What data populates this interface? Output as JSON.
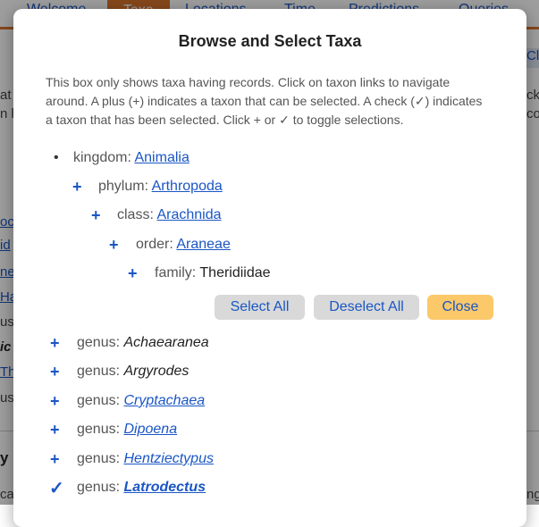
{
  "background": {
    "tabs": [
      {
        "label": "Welcome",
        "active": false
      },
      {
        "label": "Taxa",
        "active": true
      },
      {
        "label": "Locations",
        "active": false
      },
      {
        "label": "Time",
        "active": false
      },
      {
        "label": "Predictions",
        "active": false
      },
      {
        "label": "Queries",
        "active": false
      }
    ],
    "right_button_fragment": "Cle",
    "left_fragments": [
      "at",
      "n l",
      "oc",
      "id",
      "ne",
      "Ha",
      "us:",
      "ic",
      "Th",
      "us:",
      "y",
      "ca"
    ],
    "right_fragments": [
      "ck",
      "co",
      "ng"
    ]
  },
  "modal": {
    "title": "Browse and Select Taxa",
    "description": "This box only shows taxa having records. Click on taxon links to navigate around. A plus (+) indicates a taxon that can be selected. A check (✓) indicates a taxon that has been selected. Click + or ✓ to toggle selections.",
    "hierarchy": [
      {
        "rank": "kingdom:",
        "name": "Animalia",
        "link": true,
        "marker": "bullet"
      },
      {
        "rank": "phylum:",
        "name": "Arthropoda",
        "link": true,
        "marker": "plus"
      },
      {
        "rank": "class:",
        "name": "Arachnida",
        "link": true,
        "marker": "plus"
      },
      {
        "rank": "order:",
        "name": "Araneae",
        "link": true,
        "marker": "plus"
      },
      {
        "rank": "family:",
        "name": "Theridiidae",
        "link": false,
        "marker": "plus"
      }
    ],
    "buttons": {
      "select_all": "Select All",
      "deselect_all": "Deselect All",
      "close": "Close"
    },
    "genera": [
      {
        "rank": "genus:",
        "name": "Achaearanea",
        "link": false,
        "selected": false
      },
      {
        "rank": "genus:",
        "name": "Argyrodes",
        "link": false,
        "selected": false
      },
      {
        "rank": "genus:",
        "name": "Cryptachaea",
        "link": true,
        "selected": false
      },
      {
        "rank": "genus:",
        "name": "Dipoena",
        "link": true,
        "selected": false
      },
      {
        "rank": "genus:",
        "name": "Hentziectypus",
        "link": true,
        "selected": false
      },
      {
        "rank": "genus:",
        "name": "Latrodectus",
        "link": true,
        "selected": true
      }
    ],
    "icons": {
      "plus": "+",
      "check": "✓",
      "bullet": "•"
    },
    "colors": {
      "link": "#1a56c4",
      "accent_orange": "#d9742e",
      "close_button": "#fbc86a",
      "button_gray": "#d9d9d9"
    }
  }
}
